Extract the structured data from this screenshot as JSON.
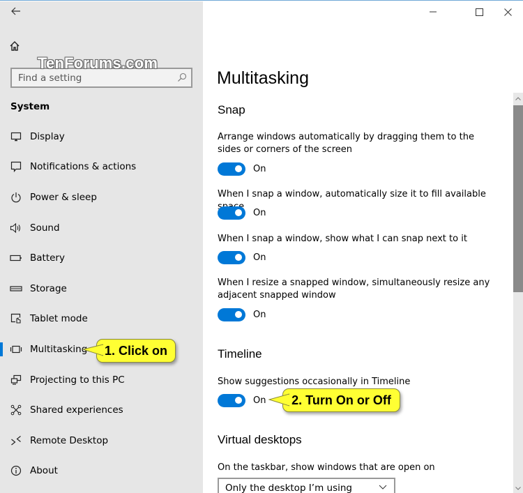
{
  "window": {
    "back_icon": "back-arrow-icon",
    "controls": {
      "minimize": "minimize-icon",
      "maximize": "maximize-icon",
      "close": "close-icon"
    }
  },
  "watermark": "TenForums.com",
  "sidebar": {
    "home_icon": "home-icon",
    "search": {
      "placeholder": "Find a setting",
      "icon": "search-icon"
    },
    "section_title": "System",
    "items": [
      {
        "label": "Display",
        "icon": "display-icon",
        "selected": false
      },
      {
        "label": "Notifications & actions",
        "icon": "notifications-icon",
        "selected": false
      },
      {
        "label": "Power & sleep",
        "icon": "power-icon",
        "selected": false
      },
      {
        "label": "Sound",
        "icon": "sound-icon",
        "selected": false
      },
      {
        "label": "Battery",
        "icon": "battery-icon",
        "selected": false
      },
      {
        "label": "Storage",
        "icon": "storage-icon",
        "selected": false
      },
      {
        "label": "Tablet mode",
        "icon": "tablet-mode-icon",
        "selected": false
      },
      {
        "label": "Multitasking",
        "icon": "multitasking-icon",
        "selected": true
      },
      {
        "label": "Projecting to this PC",
        "icon": "projecting-icon",
        "selected": false
      },
      {
        "label": "Shared experiences",
        "icon": "shared-experiences-icon",
        "selected": false
      },
      {
        "label": "Remote Desktop",
        "icon": "remote-desktop-icon",
        "selected": false
      },
      {
        "label": "About",
        "icon": "about-icon",
        "selected": false
      }
    ]
  },
  "main": {
    "title": "Multitasking",
    "snap": {
      "heading": "Snap",
      "settings": [
        {
          "description": "Arrange windows automatically by dragging them to the sides or corners of the screen",
          "state": "On"
        },
        {
          "description": "When I snap a window, automatically size it to fill available space",
          "state": "On"
        },
        {
          "description": "When I snap a window, show what I can snap next to it",
          "state": "On"
        },
        {
          "description": "When I resize a snapped window, simultaneously resize any adjacent snapped window",
          "state": "On"
        }
      ]
    },
    "timeline": {
      "heading": "Timeline",
      "settings": [
        {
          "description": "Show suggestions occasionally in Timeline",
          "state": "On"
        }
      ]
    },
    "virtual_desktops": {
      "heading": "Virtual desktops",
      "taskbar_label": "On the taskbar, show windows that are open on",
      "taskbar_value": "Only the desktop I’m using"
    }
  },
  "callouts": {
    "step1": "1. Click on",
    "step2": "2. Turn On or Off"
  },
  "colors": {
    "accent": "#0078d7",
    "sidebar_bg": "#e6e6e6",
    "callout_bg": "#ffff33",
    "scroll_thumb": "#8a8a8a"
  }
}
